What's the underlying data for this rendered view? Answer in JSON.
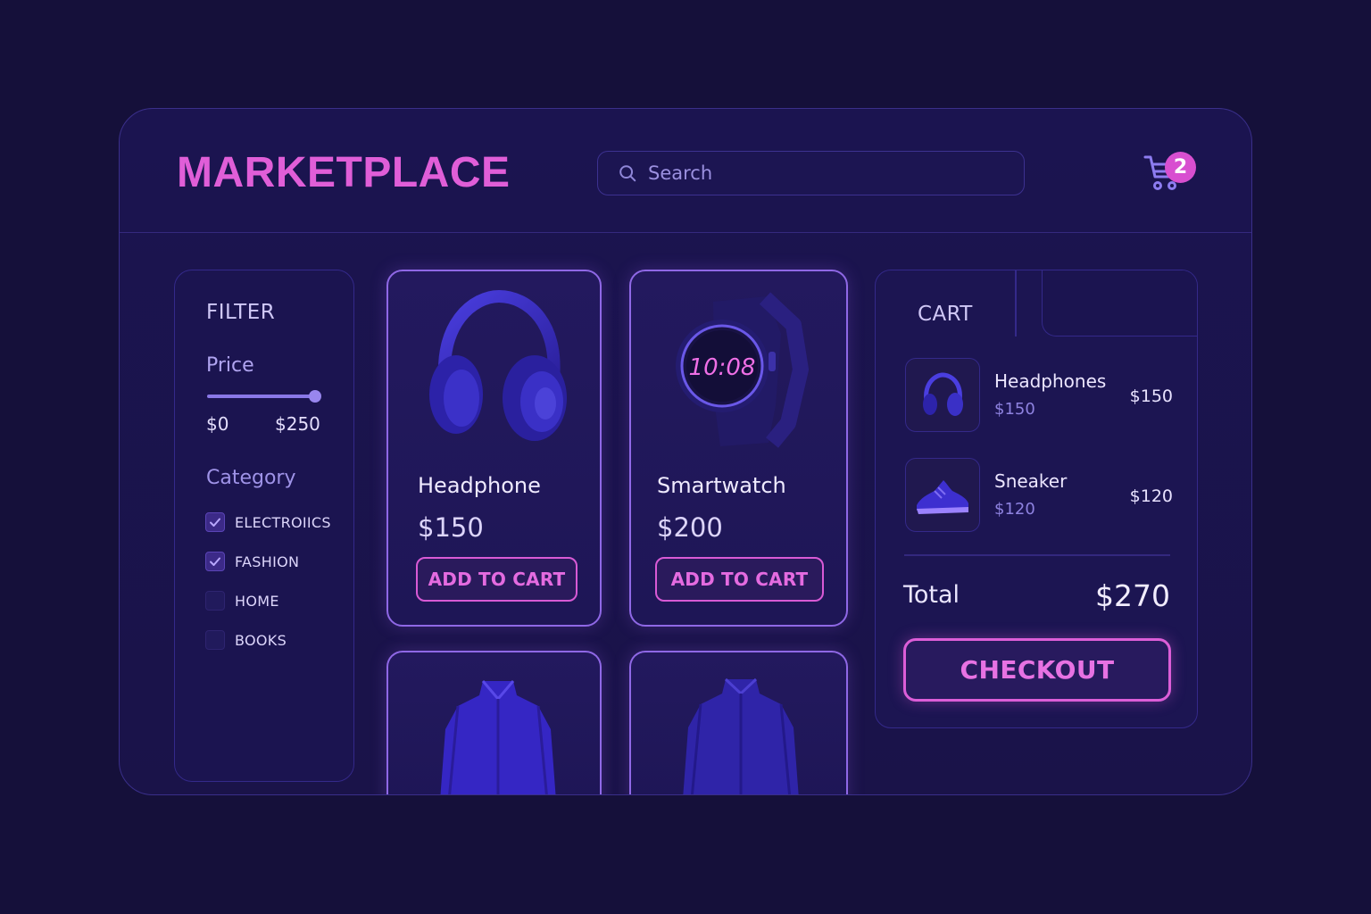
{
  "header": {
    "brand": "MARKETPLACE",
    "search_placeholder": "Search",
    "cart_count": "2"
  },
  "filter": {
    "title": "FILTER",
    "price_label": "Price",
    "price_min": "$0",
    "price_max": "$250",
    "price_slider_value": 250,
    "category_label": "Category",
    "categories": [
      {
        "label": "ELECTROIICS",
        "checked": true
      },
      {
        "label": "FASHION",
        "checked": true
      },
      {
        "label": "HOME",
        "checked": false
      },
      {
        "label": "BOOKS",
        "checked": false
      }
    ]
  },
  "products": [
    {
      "name": "Headphone",
      "price": "$150",
      "button": "ADD TO CART",
      "image": "headphones-icon"
    },
    {
      "name": "Smartwatch",
      "price": "$200",
      "button": "ADD TO CART",
      "image": "smartwatch-icon",
      "watch_time": "10:08"
    },
    {
      "image": "jacket-icon"
    },
    {
      "image": "jacket-icon"
    }
  ],
  "cart": {
    "title": "CART",
    "items": [
      {
        "name": "Headphones",
        "sub_price": "$150",
        "price": "$150",
        "image": "headphones-icon"
      },
      {
        "name": "Sneaker",
        "sub_price": "$120",
        "price": "$120",
        "image": "sneaker-icon"
      }
    ],
    "total_label": "Total",
    "total_value": "$270",
    "checkout_label": "CHECKOUT"
  },
  "colors": {
    "background": "#15103a",
    "panel": "#1b1450",
    "accent_pink": "#e05ed8",
    "accent_purple": "#8f68e6"
  }
}
